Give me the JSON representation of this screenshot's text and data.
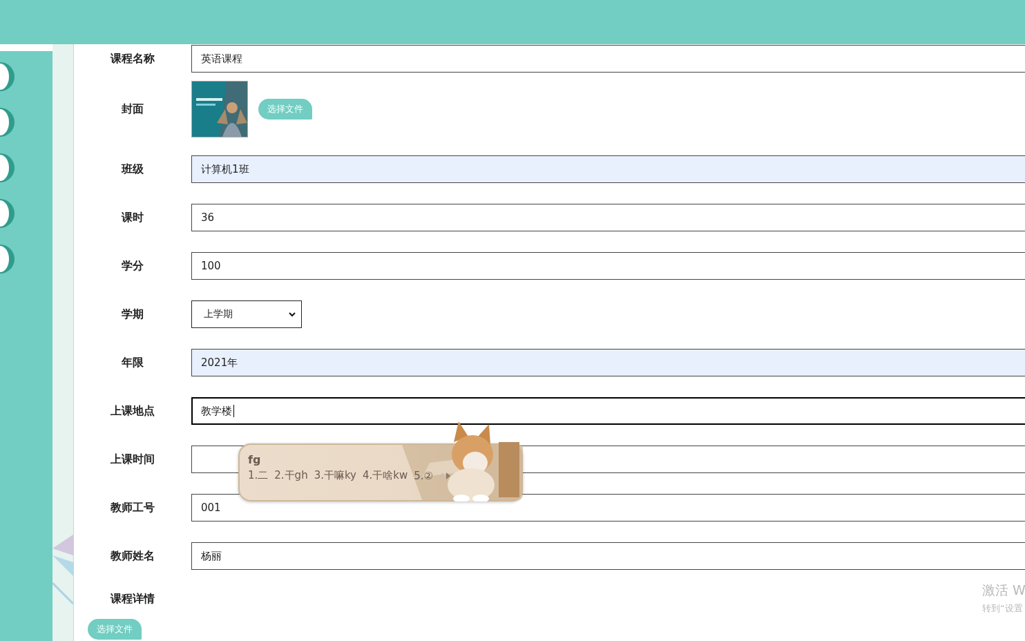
{
  "fields": [
    {
      "label": "课程名称",
      "kind": "text",
      "value": "英语课程",
      "autofilled": false,
      "focused": false
    },
    {
      "label": "封面",
      "button": "选择文件"
    },
    {
      "label": "班级",
      "kind": "text",
      "value": "计算机1班",
      "autofilled": true,
      "focused": false
    },
    {
      "label": "课时",
      "kind": "text",
      "value": "36",
      "autofilled": false,
      "focused": false
    },
    {
      "label": "学分",
      "kind": "text",
      "value": "100",
      "autofilled": false,
      "focused": false
    },
    {
      "label": "学期",
      "kind": "select",
      "value": "上学期"
    },
    {
      "label": "年限",
      "kind": "text",
      "value": "2021年",
      "autofilled": true,
      "focused": false
    },
    {
      "label": "上课地点",
      "kind": "text",
      "value": "教学楼",
      "autofilled": false,
      "focused": true
    },
    {
      "label": "上课时间",
      "kind": "text",
      "autofilled": false,
      "focused": false
    },
    {
      "label": "教师工号",
      "kind": "text",
      "value": "001",
      "autofilled": false,
      "focused": false
    },
    {
      "label": "教师姓名",
      "kind": "text",
      "value": "杨丽",
      "autofilled": false,
      "focused": false
    },
    {
      "label": "课程详情",
      "kind": "heading"
    }
  ],
  "detail_upload": {
    "button": "选择文件"
  },
  "ime": {
    "input": "fg",
    "candidates": [
      "1.二",
      "2.干gh",
      "3.干嘛ky",
      "4.干啥kw",
      "5.②"
    ]
  },
  "system_notice": {
    "title": "激活 W",
    "subtitle": "转到“设置"
  }
}
